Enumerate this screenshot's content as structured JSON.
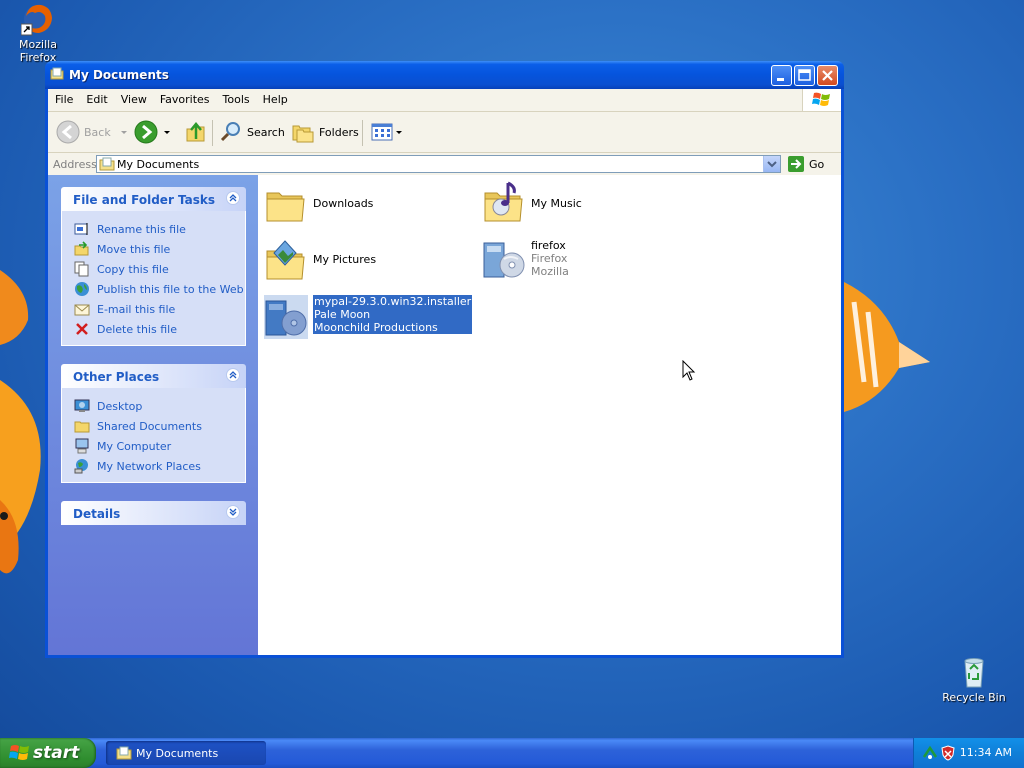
{
  "desktop": {
    "icons": [
      {
        "label": "Mozilla Firefox",
        "icon": "firefox-icon"
      },
      {
        "label": "Recycle Bin",
        "icon": "recycle-bin-icon"
      }
    ]
  },
  "window": {
    "title": "My Documents",
    "menu": [
      "File",
      "Edit",
      "View",
      "Favorites",
      "Tools",
      "Help"
    ],
    "toolbar": {
      "back": "Back",
      "search": "Search",
      "folders": "Folders"
    },
    "address": {
      "label": "Address",
      "value": "My Documents",
      "go": "Go"
    },
    "panels": {
      "tasks": {
        "title": "File and Folder Tasks",
        "items": [
          "Rename this file",
          "Move this file",
          "Copy this file",
          "Publish this file to the Web",
          "E-mail this file",
          "Delete this file"
        ]
      },
      "places": {
        "title": "Other Places",
        "items": [
          "Desktop",
          "Shared Documents",
          "My Computer",
          "My Network Places"
        ]
      },
      "details": {
        "title": "Details"
      }
    },
    "files": [
      {
        "name": "Downloads",
        "lines": []
      },
      {
        "name": "My Music",
        "lines": []
      },
      {
        "name": "My Pictures",
        "lines": []
      },
      {
        "name": "firefox",
        "lines": [
          "Firefox",
          "Mozilla"
        ]
      },
      {
        "name": "mypal-29.3.0.win32.installer",
        "lines": [
          "Pale Moon",
          "Moonchild Productions"
        ]
      }
    ]
  },
  "taskbar": {
    "start": "start",
    "task": "My Documents",
    "clock": "11:34 AM"
  },
  "colors": {
    "link": "#215dc6",
    "selection": "#316ac5",
    "titlebar": "#0a5ee8",
    "start": "#3c9a3c"
  }
}
